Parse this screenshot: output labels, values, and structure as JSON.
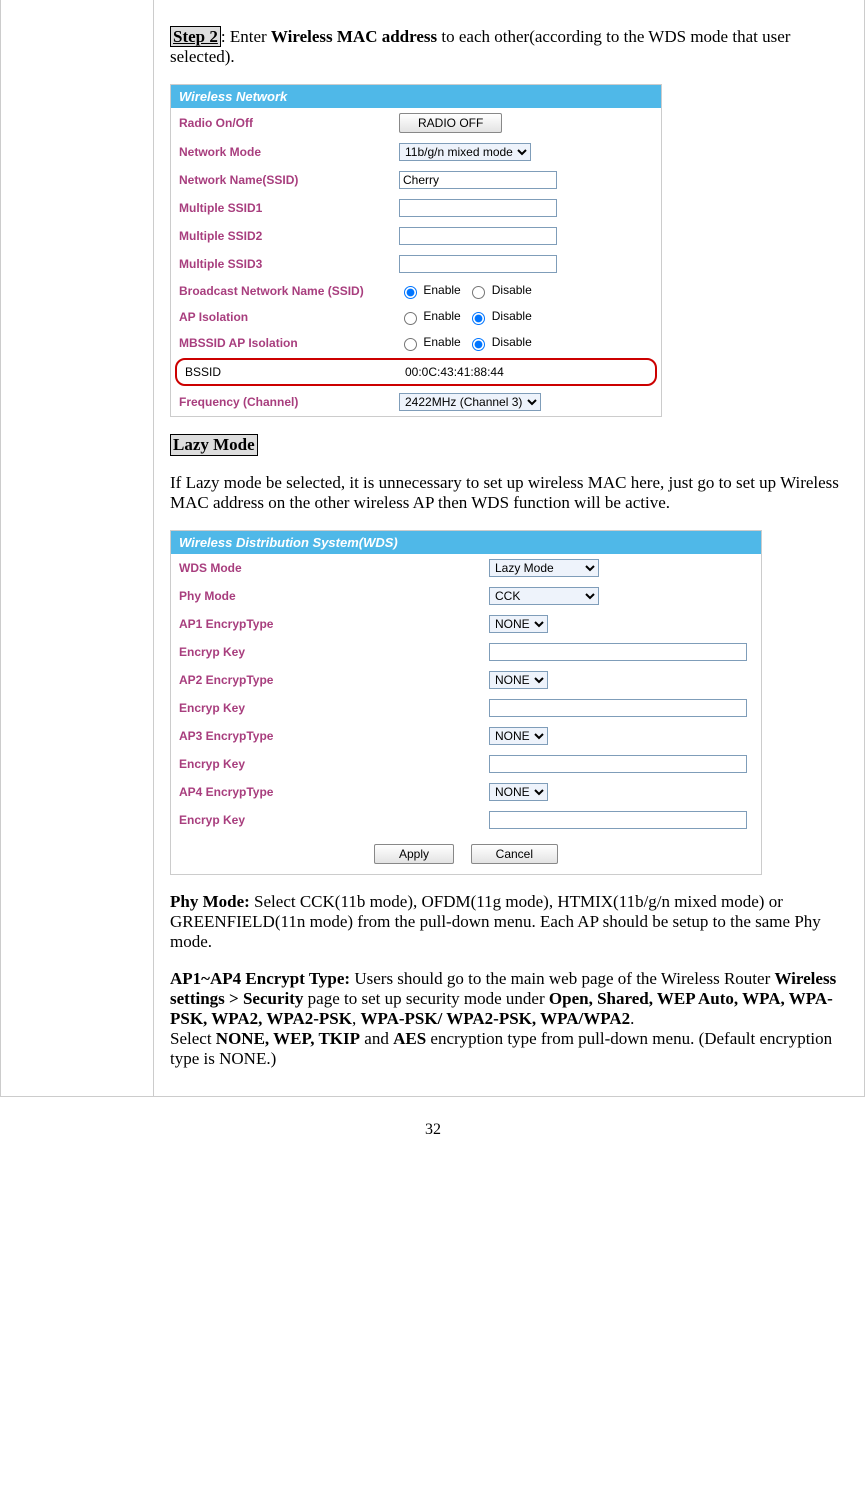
{
  "step2": {
    "label": "Step 2",
    "text_a": ": Enter ",
    "bold_a": "Wireless MAC address",
    "text_b": " to each other(according to the WDS mode that user selected)."
  },
  "panel1": {
    "title": "Wireless Network",
    "rows": {
      "radio": {
        "label": "Radio On/Off",
        "button": "RADIO OFF"
      },
      "mode": {
        "label": "Network Mode",
        "value": "11b/g/n mixed mode"
      },
      "ssid": {
        "label": "Network Name(SSID)",
        "value": "Cherry"
      },
      "m1": {
        "label": "Multiple SSID1",
        "value": ""
      },
      "m2": {
        "label": "Multiple SSID2",
        "value": ""
      },
      "m3": {
        "label": "Multiple SSID3",
        "value": ""
      },
      "bcast": {
        "label": "Broadcast Network Name (SSID)",
        "opt1": "Enable",
        "opt2": "Disable"
      },
      "apiso": {
        "label": "AP Isolation",
        "opt1": "Enable",
        "opt2": "Disable"
      },
      "mbssid": {
        "label": "MBSSID AP Isolation",
        "opt1": "Enable",
        "opt2": "Disable"
      },
      "bssid": {
        "label": "BSSID",
        "value": "00:0C:43:41:88:44"
      },
      "freq": {
        "label": "Frequency (Channel)",
        "value": "2422MHz (Channel 3)"
      }
    }
  },
  "lazy": {
    "heading": "Lazy Mode",
    "text": "If Lazy mode be selected, it is unnecessary to set up wireless MAC here, just go to set up Wireless MAC address on the other wireless AP then WDS function will be active."
  },
  "panel2": {
    "title": "Wireless Distribution System(WDS)",
    "rows": {
      "wds": {
        "label": "WDS Mode",
        "value": "Lazy Mode"
      },
      "phy": {
        "label": "Phy Mode",
        "value": "CCK"
      },
      "e1": {
        "label": "AP1 EncrypType",
        "value": "NONE"
      },
      "k1": {
        "label": "Encryp Key",
        "value": ""
      },
      "e2": {
        "label": "AP2 EncrypType",
        "value": "NONE"
      },
      "k2": {
        "label": "Encryp Key",
        "value": ""
      },
      "e3": {
        "label": "AP3 EncrypType",
        "value": "NONE"
      },
      "k3": {
        "label": "Encryp Key",
        "value": ""
      },
      "e4": {
        "label": "AP4 EncrypType",
        "value": "NONE"
      },
      "k4": {
        "label": "Encryp Key",
        "value": ""
      }
    },
    "apply": "Apply",
    "cancel": "Cancel"
  },
  "phytext": {
    "bold": "Phy Mode: ",
    "rest": "Select CCK(11b mode), OFDM(11g mode), HTMIX(11b/g/n mixed mode) or GREENFIELD(11n mode) from the pull-down menu. Each AP should be setup to the same Phy mode."
  },
  "enctext": {
    "b1": "AP1~AP4 Encrypt Type: ",
    "t1": "Users should go to the main web page of the Wireless  Router ",
    "b2": "Wireless settings > Security",
    "t2": " page to set up security mode under ",
    "b3": "Open, Shared, WEP Auto, WPA, WPA-PSK, WPA2, WPA2-PSK",
    "t3": ", ",
    "b4": "WPA-PSK/ WPA2-PSK, WPA/WPA2",
    "t4": ".",
    "t5": "Select ",
    "b5": "NONE, WEP, TKIP",
    "t6": " and ",
    "b6": "AES",
    "t7": "  encryption type from pull-down menu. (Default encryption type is NONE.)"
  },
  "pagenum": "32"
}
